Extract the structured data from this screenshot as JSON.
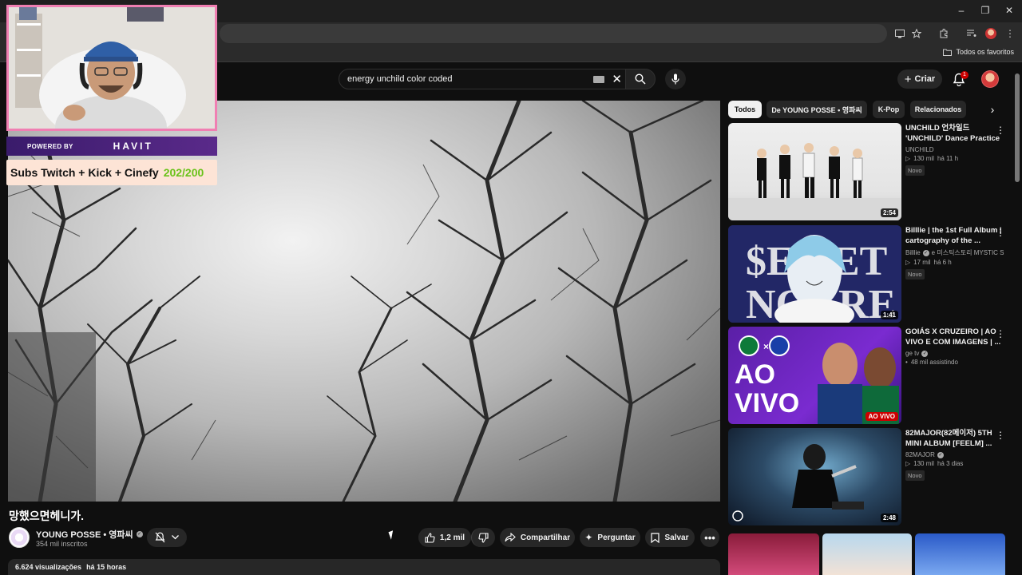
{
  "browser": {
    "window_controls": [
      "–",
      "❐",
      "✕"
    ],
    "bookmarks_all": "Todos os favoritos"
  },
  "youtube": {
    "search": {
      "value": "energy unchild color coded"
    },
    "create_label": "Criar",
    "notification_count": "1"
  },
  "overlay": {
    "powered_by": "POWERED BY",
    "sponsor": "HAVIT",
    "subs_label": "Subs Twitch + Kick + Cinefy",
    "subs_count": "202/200"
  },
  "video": {
    "title": "망했으면헤니가.",
    "channel": "YOUNG POSSE • 영파씨",
    "subscribers": "354 mil inscritos",
    "likes": "1,2 mil",
    "share_label": "Compartilhar",
    "ask_label": "Perguntar",
    "save_label": "Salvar",
    "views": "6.624 visualizações",
    "posted": "há 15 horas"
  },
  "chips": [
    "Todos",
    "De YOUNG POSSE • 영파씨",
    "K-Pop",
    "Relacionados"
  ],
  "recommendations": [
    {
      "title": "UNCHILD 언차일드 'UNCHILD' Dance Practice",
      "channel": "UNCHILD",
      "views": "130 mil",
      "age": "há 11 h",
      "badge": "Novo",
      "duration": "2:54"
    },
    {
      "title": "Billlie | the 1st Full Album | cartography of the ...",
      "channel": "Billlie",
      "channel_extra": "e 미스틱스토리 MYSTIC S",
      "views": "17 mil",
      "age": "há 6 h",
      "badge": "Novo",
      "duration": "1:41"
    },
    {
      "title": "GOIÁS X CRUZEIRO | AO VIVO E COM IMAGENS | ...",
      "channel": "ge tv",
      "views": "48 mil assistindo",
      "live_label": "AO VIVO",
      "thumb_text": "AO VIVO"
    },
    {
      "title": "82MAJOR(82메이저) 5TH MINI ALBUM [FEELM] ...",
      "channel": "82MAJOR",
      "views": "130 mil",
      "age": "há 3 dias",
      "badge": "Novo",
      "duration": "2:48"
    }
  ]
}
